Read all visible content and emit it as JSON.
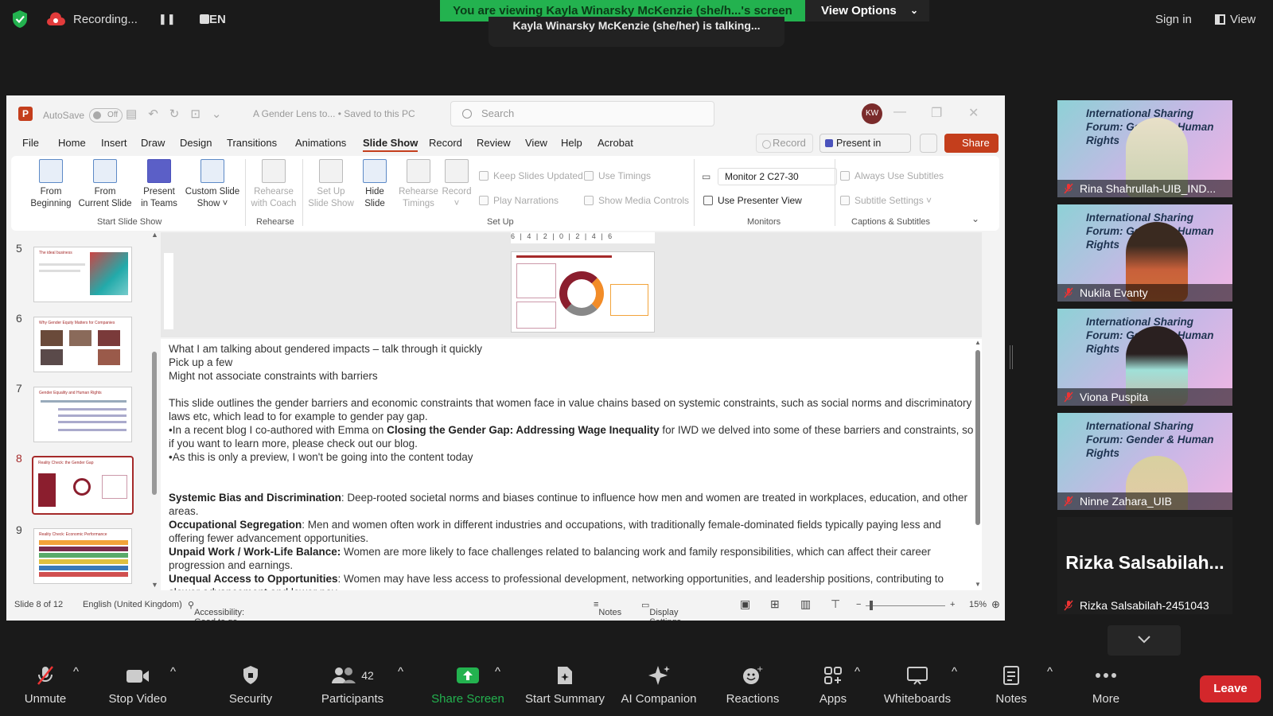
{
  "zoom": {
    "recording_label": "Recording...",
    "language": "EN",
    "viewing_banner": "You are viewing Kayla Winarsky McKenzie (she/h...'s screen",
    "view_options": "View Options",
    "talking": "Kayla Winarsky McKenzie (she/her) is talking...",
    "sign_in": "Sign in",
    "view": "View",
    "leave": "Leave",
    "colors": {
      "banner_green": "#23b24f",
      "leave_red": "#d3272b"
    }
  },
  "ppt": {
    "autosave_label": "AutoSave",
    "autosave_state": "Off",
    "doc_title": "A Gender Lens to...  •  Saved to this PC",
    "search_placeholder": "Search",
    "avatar": "KW",
    "menu": [
      "File",
      "Home",
      "Insert",
      "Draw",
      "Design",
      "Transitions",
      "Animations",
      "Slide Show",
      "Record",
      "Review",
      "View",
      "Help",
      "Acrobat"
    ],
    "active_tab": "Slide Show",
    "record_btn": "Record",
    "present_teams_btn": "Present in Teams",
    "share_btn": "Share",
    "ribbon": {
      "from_beginning": [
        "From",
        "Beginning"
      ],
      "from_current": [
        "From",
        "Current Slide"
      ],
      "present_teams": [
        "Present",
        "in Teams"
      ],
      "custom_show": [
        "Custom Slide",
        "Show ˅"
      ],
      "group_start": "Start Slide Show",
      "rehearse_coach": [
        "Rehearse",
        "with Coach"
      ],
      "group_rehearse": "Rehearse",
      "setup_show": [
        "Set Up",
        "Slide Show"
      ],
      "hide_slide": [
        "Hide",
        "Slide"
      ],
      "rehearse_timings": [
        "Rehearse",
        "Timings"
      ],
      "record": [
        "Record",
        "˅"
      ],
      "keep_updated": "Keep Slides Updated",
      "use_timings": "Use Timings",
      "play_narrations": "Play Narrations",
      "show_media": "Show Media Controls",
      "group_setup": "Set Up",
      "monitor": "Monitor 2 C27-30",
      "presenter_view": "Use Presenter View",
      "group_monitors": "Monitors",
      "always_subtitles": "Always Use Subtitles",
      "subtitle_settings": "Subtitle Settings ˅",
      "group_captions": "Captions & Subtitles"
    },
    "thumbnails": [
      {
        "num": "5",
        "title": "The ideal business"
      },
      {
        "num": "6",
        "title": "Why Gender Equity Matters for Companies"
      },
      {
        "num": "7",
        "title": "Gender Equality and Human Rights"
      },
      {
        "num": "8",
        "title": "Reality Check: the Gender Gap"
      },
      {
        "num": "9",
        "title": "Reality Check: Economic Performance"
      }
    ],
    "selected_slide": "8",
    "ruler_text": "6 | 4 | 2 | 0 | 2 | 4 | 6",
    "notes": {
      "line1": "What I am talking about gendered impacts – talk through it quickly",
      "line2": "Pick up a few",
      "line3": "Might not associate constraints with barriers",
      "para1": "This slide outlines the gender barriers and economic constraints that women face in value chains based on systemic constraints, such as social norms and discriminatory laws etc, which lead to for example to gender pay gap.",
      "para2_pre": "•In a recent blog I co-authored with Emma on ",
      "para2_bold": "Closing the Gender Gap: Addressing Wage Inequality",
      "para2_post": " for IWD we delved into some of these barriers and constraints, so if you want to learn more, please check out our blog.",
      "para3": "•As this is only a preview, I won't be going into the content today",
      "b1_title": "Systemic Bias and Discrimination",
      "b1_text": ": Deep-rooted societal norms and biases continue to influence how men and women are treated in workplaces, education, and other areas.",
      "b2_title": "Occupational Segregation",
      "b2_text": ": Men and women often work in different industries and occupations, with traditionally female-dominated fields typically paying less and offering fewer advancement opportunities.",
      "b3_title": "Unpaid Work / Work-Life Balance:",
      "b3_text": " Women are more likely to face challenges related to balancing work and family responsibilities, which can affect their career progression and earnings.",
      "b4_title": "Unequal Access to Opportunities",
      "b4_text": ": Women may have less access to professional development, networking opportunities, and leadership positions, contributing to slower advancement and lower pay."
    },
    "status": {
      "slide": "Slide 8 of 12",
      "language": "English (United Kingdom)",
      "accessibility": "Accessibility: Good to go",
      "notes": "Notes",
      "display": "Display Settings",
      "zoom": "15%"
    }
  },
  "participants": [
    {
      "name": "Rina Shahrullah-UIB_IND...",
      "banner": "International Sharing Forum: Gender & Human Rights"
    },
    {
      "name": "Nukila Evanty",
      "banner": "International Sharing Forum: Gender & Human Rights"
    },
    {
      "name": "Viona Puspita",
      "banner": "International Sharing Forum: Gender & Human Rights"
    },
    {
      "name": "Ninne Zahara_UIB",
      "banner": "International Sharing Forum: Gender & Human Rights"
    },
    {
      "name": "Rizka Salsabilah-2451043",
      "display": "Rizka  Salsabilah..."
    }
  ],
  "toolbar": {
    "unmute": "Unmute",
    "stop_video": "Stop Video",
    "security": "Security",
    "participants": "Participants",
    "participants_count": "42",
    "share_screen": "Share Screen",
    "start_summary": "Start Summary",
    "ai_companion": "AI Companion",
    "reactions": "Reactions",
    "apps": "Apps",
    "whiteboards": "Whiteboards",
    "notes": "Notes",
    "more": "More"
  }
}
